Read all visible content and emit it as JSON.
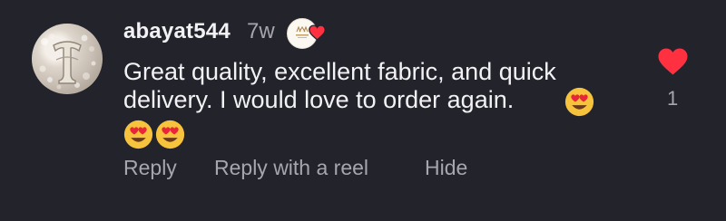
{
  "comment": {
    "username": "abayat544",
    "time": "7w",
    "text_line1": "Great quality, excellent fabric, and quick",
    "text_line2": "delivery. I would love to order again.",
    "emoji_inline": "heart-eyes-emoji",
    "emoji_trailing": [
      "heart-eyes-emoji",
      "heart-eyes-emoji"
    ],
    "author_liked": true
  },
  "actions": {
    "reply": "Reply",
    "reply_with_reel": "Reply with a reel",
    "hide": "Hide"
  },
  "likes": {
    "count": "1",
    "liked": true
  },
  "colors": {
    "background": "#22232b",
    "text": "#f2f2f5",
    "muted": "#a6a7ad",
    "heart": "#ff3040"
  }
}
